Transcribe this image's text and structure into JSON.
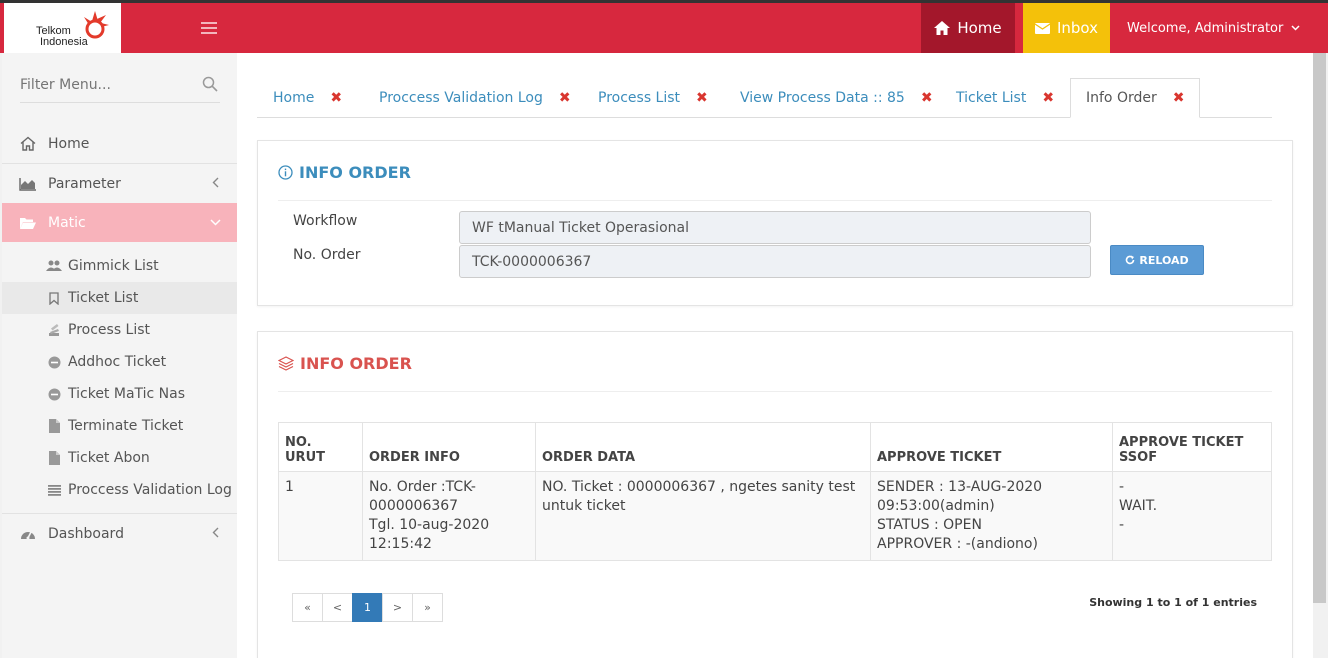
{
  "brand": {
    "line1": "Telkom",
    "line2": "Indonesia"
  },
  "topnav": {
    "home": "Home",
    "inbox": "Inbox",
    "user": "Welcome, Administrator"
  },
  "sidebar": {
    "filter_placeholder": "Filter Menu...",
    "items": [
      {
        "label": "Home"
      },
      {
        "label": "Parameter"
      },
      {
        "label": "Matic"
      },
      {
        "label": "Dashboard"
      }
    ],
    "subitems": [
      {
        "label": "Gimmick List"
      },
      {
        "label": "Ticket List"
      },
      {
        "label": "Process List"
      },
      {
        "label": "Addhoc Ticket"
      },
      {
        "label": "Ticket MaTic Nas"
      },
      {
        "label": "Terminate Ticket"
      },
      {
        "label": "Ticket Abon"
      },
      {
        "label": "Proccess Validation Log"
      }
    ]
  },
  "tabs": [
    {
      "label": "Home"
    },
    {
      "label": "Proccess Validation Log"
    },
    {
      "label": "Process List"
    },
    {
      "label": "View Process Data :: 85"
    },
    {
      "label": "Ticket List"
    },
    {
      "label": "Info Order"
    }
  ],
  "info_panel": {
    "title": "INFO ORDER",
    "workflow_label": "Workflow",
    "workflow_value": "WF tManual Ticket Operasional",
    "order_label": "No. Order",
    "order_value": "TCK-0000006367",
    "reload": "RELOAD"
  },
  "order_panel": {
    "title": "INFO ORDER",
    "columns": {
      "c1a": "NO.",
      "c1b": "URUT",
      "c2": "ORDER INFO",
      "c3": "ORDER DATA",
      "c4": "APPROVE TICKET",
      "c5a": "APPROVE TICKET",
      "c5b": "SSOF"
    },
    "row": {
      "no": "1",
      "info1": "No. Order :TCK-",
      "info2": "0000006367",
      "info3": "Tgl. 10-aug-2020",
      "info4": "12:15:42",
      "data1": "NO. Ticket : 0000006367 , ngetes sanity test",
      "data2": "untuk ticket",
      "appr1": "SENDER : 13-AUG-2020",
      "appr2": "09:53:00(admin)",
      "appr3": "STATUS : OPEN",
      "appr4": "APPROVER : -(andiono)",
      "ssof1": "-",
      "ssof2": "WAIT.",
      "ssof3": "-"
    },
    "pager": {
      "first": "«",
      "prev": "<",
      "page": "1",
      "next": ">",
      "last": "»"
    },
    "showing": "Showing 1 to 1 of 1 entries"
  },
  "colors": {
    "brand_red": "#d7283e",
    "home_dark": "#a3172b",
    "inbox_yellow": "#f4c10a",
    "active_menu": "#f8b3bb",
    "link_blue": "#3c8dbc",
    "danger": "#d9534f"
  }
}
